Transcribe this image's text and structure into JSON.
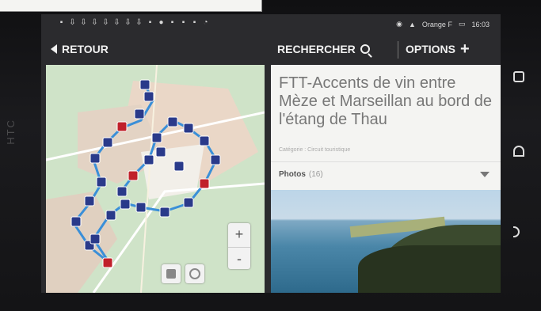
{
  "status_bar": {
    "carrier": "Orange F",
    "time": "16:03"
  },
  "action_bar": {
    "back_label": "RETOUR",
    "search_label": "RECHERCHER",
    "options_label": "OPTIONS"
  },
  "map": {
    "zoom_in": "+",
    "zoom_out": "-",
    "markers": [
      "1",
      "2",
      "3",
      "4",
      "5",
      "6",
      "7",
      "8",
      "9",
      "10",
      "11",
      "12",
      "13",
      "14",
      "15",
      "16",
      "17",
      "18",
      "19",
      "20",
      "21",
      "22",
      "23",
      "24",
      "25",
      "26",
      "27",
      "28"
    ]
  },
  "detail": {
    "title": "FTT-Accents de vin entre Mèze et Marseillan au bord de l'étang de Thau",
    "category": "Catégorie : Circuit touristique",
    "photos_label": "Photos",
    "photos_count": "(16)"
  },
  "colors": {
    "action_bar_bg": "#2b2b2e",
    "map_bg": "#cfe3c8",
    "route": "#3a8fd8",
    "detail_bg": "#f4f4f2"
  }
}
